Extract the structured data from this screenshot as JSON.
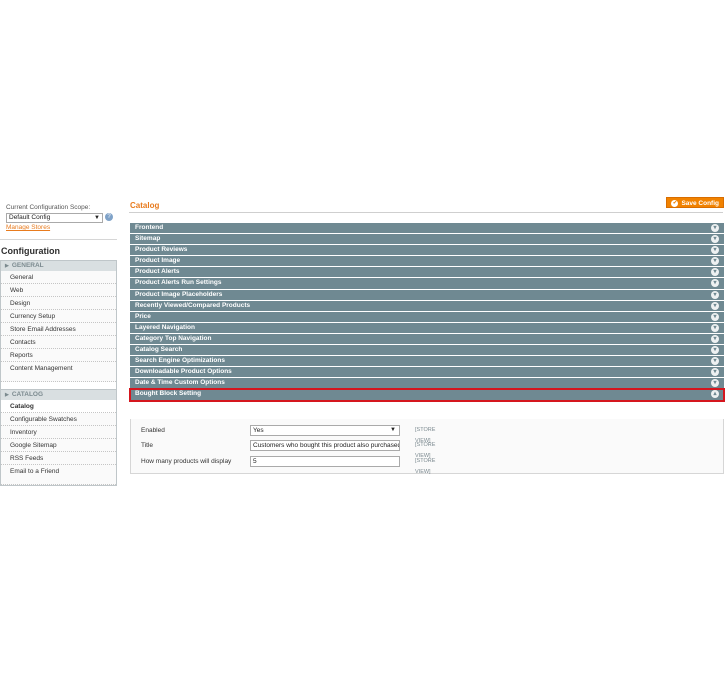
{
  "sidebar": {
    "scope_label": "Current Configuration Scope:",
    "scope_value": "Default Config",
    "manage_stores": "Manage Stores",
    "config_title": "Configuration",
    "general_head": "GENERAL",
    "general_items": [
      "General",
      "Web",
      "Design",
      "Currency Setup",
      "Store Email Addresses",
      "Contacts",
      "Reports",
      "Content Management"
    ],
    "catalog_head": "CATALOG",
    "catalog_items": [
      "Catalog",
      "Configurable Swatches",
      "Inventory",
      "Google Sitemap",
      "RSS Feeds",
      "Email to a Friend"
    ]
  },
  "main": {
    "title": "Catalog",
    "save_label": "Save Config",
    "panels": [
      "Frontend",
      "Sitemap",
      "Product Reviews",
      "Product Image",
      "Product Alerts",
      "Product Alerts Run Settings",
      "Product Image Placeholders",
      "Recently Viewed/Compared Products",
      "Price",
      "Layered Navigation",
      "Category Top Navigation",
      "Catalog Search",
      "Search Engine Optimizations",
      "Downloadable Product Options",
      "Date & Time Custom Options",
      "Bought Block Setting"
    ]
  },
  "fields": {
    "enabled_label": "Enabled",
    "enabled_value": "Yes",
    "title_label": "Title",
    "title_value": "Customers who bought this product also purchased",
    "count_label": "How many products will display",
    "count_value": "5",
    "scope_tag": "[STORE VIEW]"
  },
  "colors": {
    "accent": "#e87b1e",
    "panel": "#6f8992",
    "highlight": "#d5161e"
  }
}
